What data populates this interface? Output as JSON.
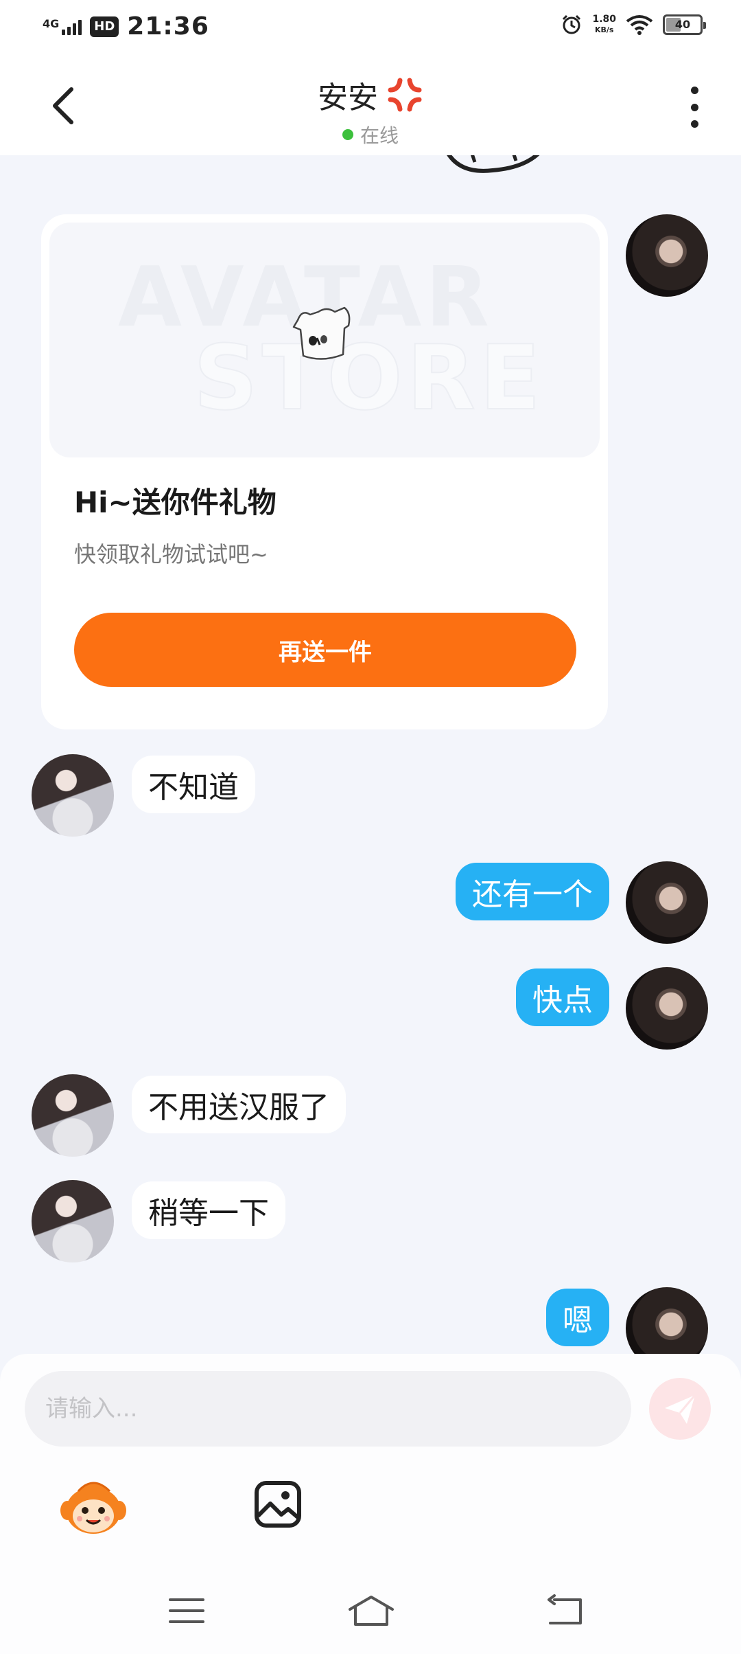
{
  "status_bar": {
    "network": "4G",
    "hd": "HD",
    "time": "21:36",
    "speed_value": "1.80",
    "speed_unit": "KB/s",
    "battery": "40",
    "battery_level": 0.4
  },
  "header": {
    "title": "安安",
    "status": "在线",
    "status_color": "#3cc03c",
    "icons": [
      "back-arrow-icon",
      "anger-emoji-icon",
      "more-vertical-icon"
    ]
  },
  "gift_card": {
    "title": "Hi~送你件礼物",
    "subtitle": "快领取礼物试试吧~",
    "button_label": "再送一件",
    "button_color": "#fc7012",
    "watermark_lines": [
      "AVATAR",
      "STORE"
    ]
  },
  "messages": [
    {
      "from": "other",
      "text": "不知道"
    },
    {
      "from": "me",
      "text": "还有一个"
    },
    {
      "from": "me",
      "text": "快点"
    },
    {
      "from": "other",
      "text": "不用送汉服了"
    },
    {
      "from": "other",
      "text": "稍等一下"
    },
    {
      "from": "me",
      "text": "嗯"
    }
  ],
  "colors": {
    "bubble_out": "#26b1f4",
    "bubble_in": "#ffffff",
    "background": "#f3f5fb"
  },
  "input": {
    "placeholder": "请输入...",
    "value": ""
  },
  "toolbar": {
    "icons": [
      "mascot-sticker-icon",
      "image-picker-icon",
      "send-icon"
    ]
  },
  "nav": {
    "icons": [
      "menu-icon",
      "home-icon",
      "back-icon"
    ]
  }
}
